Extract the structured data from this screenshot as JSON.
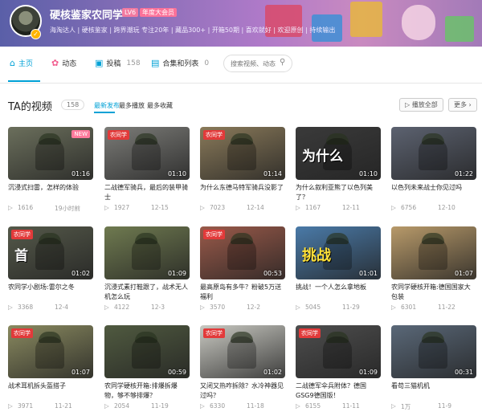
{
  "header": {
    "username": "硬核鉴家农同学",
    "level": "LV6",
    "vip_badge": "年度大会员",
    "bio": "海淘达人 | 硬核鉴家 | 跨界潮玩 专注20年 | 藏品300+ | 开箱50期 | 喜欢就好 | 欢迎原创 | 持续输出",
    "colors": {
      "banner_start": "#5a5fa8",
      "banner_end": "#a27ab8",
      "accent": "#00a1d6"
    }
  },
  "nav": {
    "items": [
      {
        "label": "主页",
        "icon": "home-icon",
        "active": true
      },
      {
        "label": "动态",
        "icon": "dynamic-icon"
      },
      {
        "label": "投稿",
        "icon": "video-icon",
        "count": "158"
      },
      {
        "label": "合集和列表",
        "icon": "collection-icon",
        "count": "0"
      }
    ],
    "search_placeholder": "搜索视频、动态"
  },
  "section": {
    "title": "TA的视频",
    "count": "158",
    "sorts": [
      "最新发布",
      "最多播放",
      "最多收藏"
    ],
    "play_all": "▷ 播放全部",
    "more": "更多 ›"
  },
  "videos": [
    {
      "title": "沉浸式扫雷，怎样的体验",
      "views": "1616",
      "date": "19小时前",
      "duration": "01:16",
      "badge_new": "NEW",
      "bg": "#6b6f5c"
    },
    {
      "title": "二战德军骑兵，最后的装甲骑士",
      "views": "1927",
      "date": "12-15",
      "duration": "01:10",
      "tag": "农同学",
      "bg": "#7c7c78"
    },
    {
      "title": "为什么东德马特军骑兵没影了",
      "views": "7023",
      "date": "12-14",
      "duration": "01:14",
      "tag": "农同学",
      "bg": "#8a7a5a"
    },
    {
      "title": "为什么叙利亚熊了以色列美了？",
      "views": "1167",
      "date": "12-11",
      "duration": "01:10",
      "overlay": "为什么",
      "bg": "#3a3a3a"
    },
    {
      "title": "以色列未来战士你见过吗",
      "views": "6756",
      "date": "12-10",
      "duration": "01:22",
      "bg": "#5c6270"
    },
    {
      "title": "农同学小剧场:雷尔之冬",
      "views": "3368",
      "date": "12-4",
      "duration": "01:02",
      "tag": "农同学",
      "overlay": "首",
      "bg": "#55594a"
    },
    {
      "title": "沉浸式素打鞋跟了，战术无人机怎么玩",
      "views": "4122",
      "date": "12-3",
      "duration": "01:09",
      "bg": "#6f7a50"
    },
    {
      "title": "最高原岛有多牛？粉破5万送福利",
      "views": "3570",
      "date": "12-2",
      "duration": "00:53",
      "tag": "农同学",
      "bg": "#9a5a4a"
    },
    {
      "title": "挑战！一个人怎么拿地板",
      "views": "5045",
      "date": "11-29",
      "duration": "01:01",
      "overlay": "挑战",
      "bg": "#4a7aa8"
    },
    {
      "title": "农同学硬核开箱:德国国家大包装",
      "views": "6301",
      "date": "11-22",
      "duration": "01:07",
      "bg": "#b89a6a"
    },
    {
      "title": "战术耳机拆头盔搭子",
      "views": "3971",
      "date": "11-21",
      "duration": "01:07",
      "tag": "农同学",
      "bg": "#8a8a60"
    },
    {
      "title": "农同学硬核开箱:排爆拆爆物，够不够排爆？",
      "views": "2054",
      "date": "11-19",
      "duration": "00:59",
      "bg": "#505a40"
    },
    {
      "title": "又闭又热咋拆除？水冷神器见过吗？",
      "views": "6330",
      "date": "11-18",
      "duration": "01:02",
      "tag": "农同学",
      "bg": "#c9c9c2"
    },
    {
      "title": "二战德军伞兵附体？德国GSG9德国版！",
      "views": "6155",
      "date": "11-11",
      "duration": "01:09",
      "tag": "农同学",
      "bg": "#4e4e4e"
    },
    {
      "title": "看苟三猫机机",
      "views": "1万",
      "date": "11-9",
      "duration": "00:31",
      "bg": "#5a6878"
    }
  ]
}
